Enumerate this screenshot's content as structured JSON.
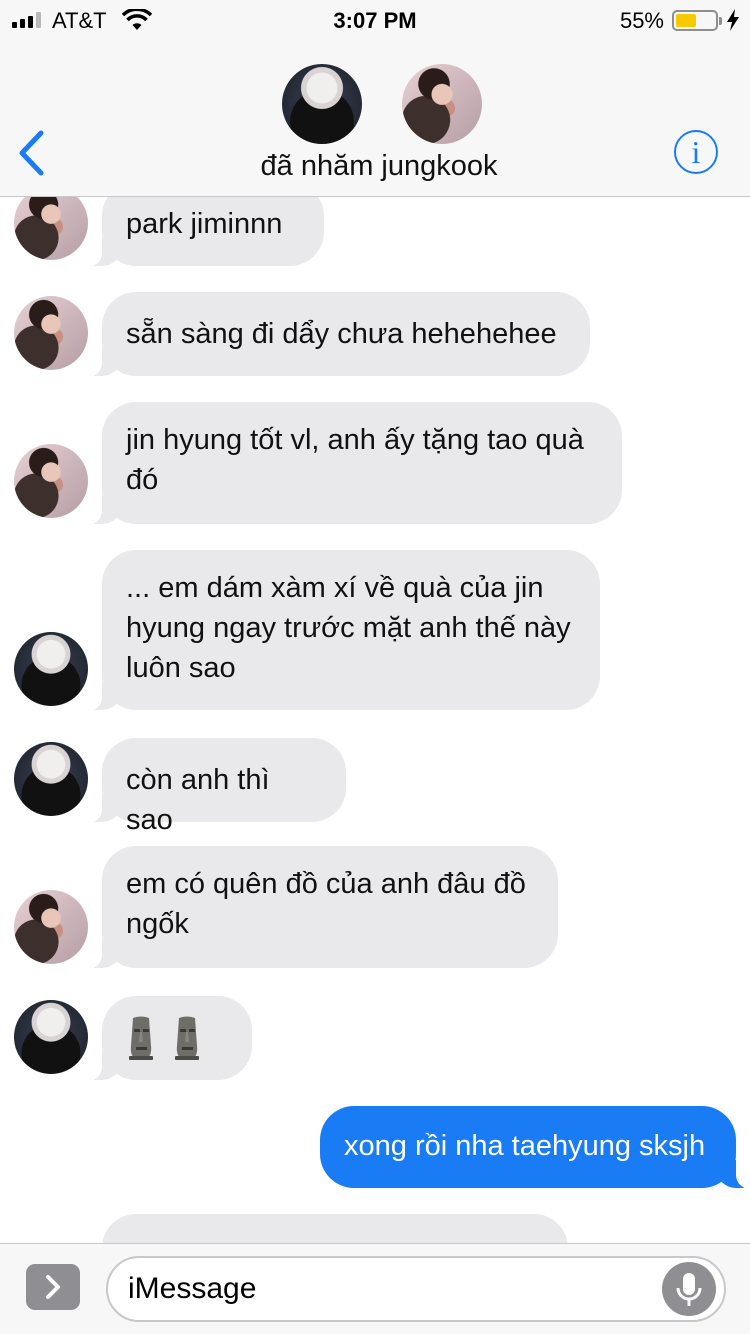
{
  "status": {
    "carrier": "AT&T",
    "time": "3:07 PM",
    "battery": "55%",
    "battery_level": 0.55
  },
  "header": {
    "title": "đã nhăm jungkook"
  },
  "composer": {
    "placeholder": "iMessage"
  },
  "messages": [
    {
      "sender": "jungkook",
      "direction": "incoming",
      "text": "park jiminnn"
    },
    {
      "sender": "jungkook",
      "direction": "incoming",
      "text": "sẵn sàng đi dẩy chưa hehehehee"
    },
    {
      "sender": "jungkook",
      "direction": "incoming",
      "lines": [
        "jin hyung tốt vl, anh ấy tặng tao quà",
        "đó"
      ]
    },
    {
      "sender": "yoongi",
      "direction": "incoming",
      "lines": [
        "... em dám xàm xí về quà của jin",
        "hyung ngay trước mặt anh thế này",
        "luôn sao"
      ]
    },
    {
      "sender": "yoongi",
      "direction": "incoming",
      "text": "còn anh thì sao"
    },
    {
      "sender": "jungkook",
      "direction": "incoming",
      "lines": [
        "em có quên đồ của anh đâu đồ",
        "ngốk"
      ]
    },
    {
      "sender": "yoongi",
      "direction": "incoming",
      "emoji": [
        "moai-icon",
        "moai-icon"
      ]
    },
    {
      "sender": "me",
      "direction": "outgoing",
      "text": "xong rồi nha taehyung sksjh"
    }
  ],
  "colors": {
    "accent": "#1a7cf5",
    "incoming_bubble": "#e9e9eb",
    "header_bg": "#f7f7f7"
  }
}
